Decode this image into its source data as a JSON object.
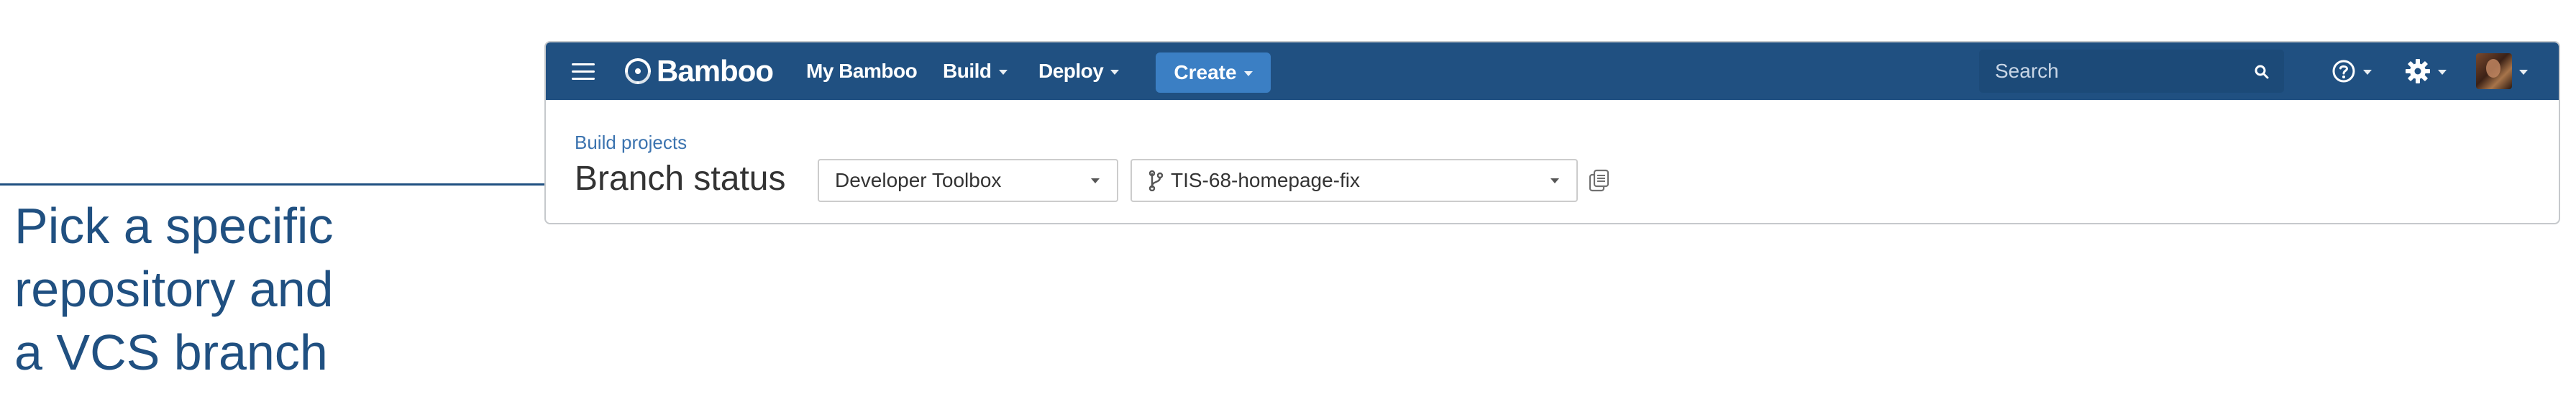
{
  "annotation": {
    "text": "Pick a specific\nrepository and\na VCS branch"
  },
  "topnav": {
    "logo": "Bamboo",
    "my_bamboo": "My Bamboo",
    "build": "Build",
    "deploy": "Deploy",
    "create": "Create",
    "search_placeholder": "Search",
    "bg_color": "#205081",
    "create_color": "#3b7fc4",
    "icons": {
      "menu": "menu-icon",
      "logo": "bamboo-logo-icon",
      "search": "search-icon",
      "help": "help-icon",
      "settings": "gear-icon",
      "avatar": "user-avatar"
    }
  },
  "content": {
    "breadcrumb": "Build projects",
    "title": "Branch status",
    "repository": {
      "value": "Developer Toolbox"
    },
    "branch": {
      "value": "TIS-68-homepage-fix",
      "icon": "branch-icon"
    },
    "copy_icon": "copy-icon",
    "link_color": "#3b73af"
  }
}
